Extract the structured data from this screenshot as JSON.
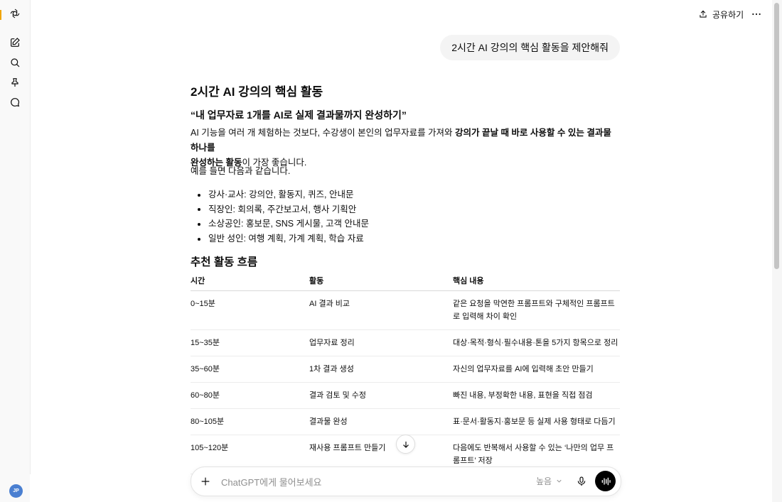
{
  "header": {
    "share_label": "공유하기"
  },
  "sidebar": {
    "avatar_initials": "JP"
  },
  "conversation": {
    "user_message": "2시간 AI 강의의 핵심 활동을 제안해줘",
    "answer": {
      "title": "2시간 AI 강의의 핵심 활동",
      "quote": "“내 업무자료 1개를 AI로 실제 결과물까지 완성하기”",
      "intro_part1": "AI 기능을 여러 개 체험하는 것보다, 수강생이 본인의 업무자료를 가져와 ",
      "intro_bold1": "강의가 끝날 때 바로 사용할 수 있는 결과물 하나를",
      "intro_bold2": "완성하는 활동",
      "intro_part2": "이 가장 좋습니다.",
      "examples_lead": "예를 들면 다음과 같습니다.",
      "examples": [
        "강사·교사: 강의안, 활동지, 퀴즈, 안내문",
        "직장인: 회의록, 주간보고서, 행사 기획안",
        "소상공인: 홍보문, SNS 게시물, 고객 안내문",
        "일반 성인: 여행 계획, 가계 계획, 학습 자료"
      ],
      "flow_heading": "추천 활동 흐름",
      "table": {
        "headers": [
          "시간",
          "활동",
          "핵심 내용"
        ],
        "rows": [
          [
            "0~15분",
            "AI 결과 비교",
            "같은 요청을 막연한 프롬프트와 구체적인 프롬프트로 입력해 차이 확인"
          ],
          [
            "15~35분",
            "업무자료 정리",
            "대상·목적·형식·필수내용·톤을 5가지 항목으로 정리"
          ],
          [
            "35~60분",
            "1차 결과 생성",
            "자신의 업무자료를 AI에 입력해 초안 만들기"
          ],
          [
            "60~80분",
            "결과 검토 및 수정",
            "빠진 내용, 부정확한 내용, 표현을 직접 점검"
          ],
          [
            "80~105분",
            "결과물 완성",
            "표·문서·활동지·홍보문 등 실제 사용 형태로 다듬기"
          ],
          [
            "105~120분",
            "재사용 프롬프트 만들기",
            "다음에도 반복해서 사용할 수 있는 ‘나만의 업무 프롬프트’ 저장"
          ]
        ]
      }
    }
  },
  "composer": {
    "placeholder": "ChatGPT에게 물어보세요",
    "model_label": "높음"
  },
  "colors": {
    "bubble": "#f4f4f4",
    "voice_button": "#000000",
    "avatar": "#4a7fd1"
  }
}
